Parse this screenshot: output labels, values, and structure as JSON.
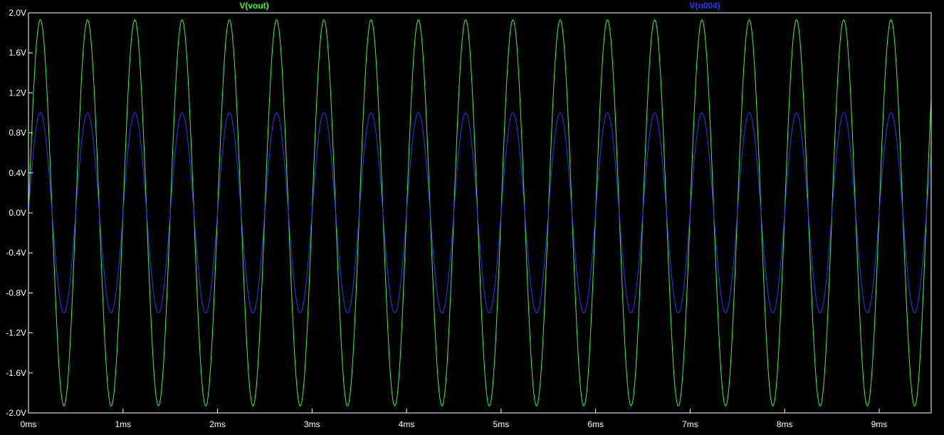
{
  "chart_data": {
    "type": "line",
    "title": "",
    "xlabel": "",
    "ylabel": "",
    "xlim": [
      0,
      9.55
    ],
    "ylim": [
      -2.0,
      2.0
    ],
    "x_unit": "ms",
    "grid": false,
    "legend_position": "top",
    "x_ticks": [
      0,
      1,
      2,
      3,
      4,
      5,
      6,
      7,
      8,
      9
    ],
    "x_tick_labels": [
      "0ms",
      "1ms",
      "2ms",
      "3ms",
      "4ms",
      "5ms",
      "6ms",
      "7ms",
      "8ms",
      "9ms"
    ],
    "y_ticks": [
      2.0,
      1.6,
      1.2,
      0.8,
      0.4,
      0.0,
      -0.4,
      -0.8,
      -1.2,
      -1.6,
      -2.0
    ],
    "y_tick_labels": [
      "2.0V",
      "1.6V",
      "1.2V",
      "0.8V",
      "0.4V",
      "0.0V",
      "-0.4V",
      "-0.8V",
      "-1.2V",
      "-1.6V",
      "-2.0V"
    ],
    "series": [
      {
        "name": "V(vout)",
        "color": "#33ff33",
        "waveform": "sine",
        "amplitude": 1.93,
        "frequency_khz": 2,
        "phase_deg": 0,
        "offset": 0
      },
      {
        "name": "V(n004)",
        "color": "#3333ff",
        "waveform": "sine",
        "amplitude": 1.0,
        "frequency_khz": 2,
        "phase_deg": 0,
        "offset": 0
      }
    ],
    "colors": {
      "background": "#000000",
      "axis": "#ffffff",
      "tick_text": "#ffffff"
    }
  }
}
